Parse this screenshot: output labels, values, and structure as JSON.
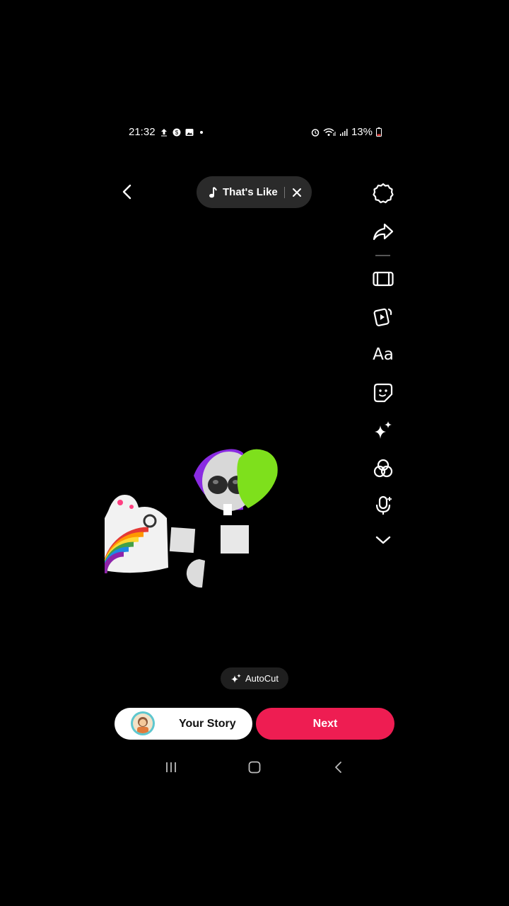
{
  "status_bar": {
    "time": "21:32",
    "battery": "13%",
    "icons": [
      "upload-icon",
      "messenger-icon",
      "gallery-icon",
      "alarm-icon",
      "wifi-icon",
      "signal-icon",
      "battery-icon"
    ]
  },
  "top_bar": {
    "back_icon": "chevron-left-icon",
    "music_title": "That's Like",
    "music_icon": "music-note-icon",
    "close_icon": "close-icon"
  },
  "toolbar": {
    "items": [
      {
        "name": "settings",
        "icon": "gear-icon"
      },
      {
        "name": "share",
        "icon": "share-arrow-icon"
      },
      {
        "name": "flip",
        "icon": "screen-ratio-icon"
      },
      {
        "name": "templates",
        "icon": "video-cards-icon"
      },
      {
        "name": "text",
        "icon": "text-icon",
        "label": "Aa"
      },
      {
        "name": "stickers",
        "icon": "sticker-icon"
      },
      {
        "name": "effects",
        "icon": "sparkle-icon"
      },
      {
        "name": "filters",
        "icon": "filters-icon"
      },
      {
        "name": "voice",
        "icon": "voice-effects-icon"
      },
      {
        "name": "more",
        "icon": "chevron-down-icon"
      }
    ]
  },
  "autocut": {
    "label": "AutoCut",
    "icon": "sparkle-icon"
  },
  "bottom": {
    "your_story_label": "Your Story",
    "next_label": "Next"
  },
  "colors": {
    "accent": "#ee1d52",
    "pill_bg": "#2a2a2a",
    "background": "#000000"
  }
}
